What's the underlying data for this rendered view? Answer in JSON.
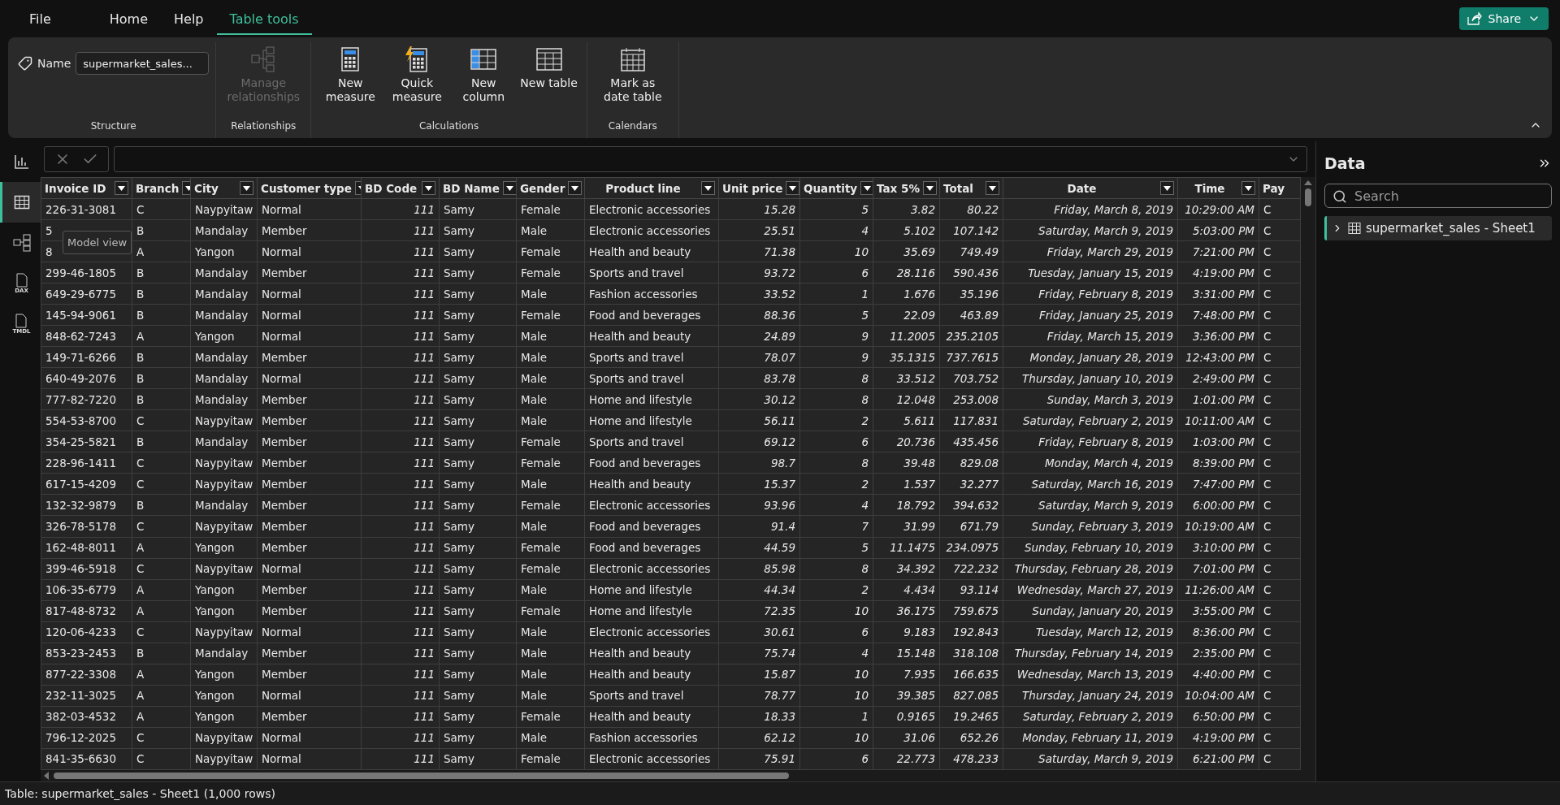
{
  "menu": {
    "tabs": [
      {
        "label": "File",
        "selected": false
      },
      {
        "label": "Home",
        "selected": false
      },
      {
        "label": "Help",
        "selected": false
      },
      {
        "label": "Table tools",
        "selected": true
      }
    ],
    "share": "Share"
  },
  "ribbon": {
    "name_field": {
      "label": "Name",
      "value": "supermarket_sales..."
    },
    "groups": [
      {
        "label": "Structure"
      },
      {
        "label": "Relationships",
        "items": [
          {
            "kind": "relationships",
            "label": "Manage relationships",
            "disabled": true
          }
        ]
      },
      {
        "label": "Calculations",
        "items": [
          {
            "kind": "measure",
            "label": "New measure",
            "disabled": false
          },
          {
            "kind": "quick-measure",
            "label": "Quick measure",
            "disabled": false
          },
          {
            "kind": "column",
            "label": "New column",
            "disabled": false
          },
          {
            "kind": "table",
            "label": "New table",
            "disabled": false
          }
        ]
      },
      {
        "label": "Calendars",
        "items": [
          {
            "kind": "date-table",
            "label": "Mark as date table",
            "disabled": false
          }
        ]
      }
    ]
  },
  "rail": [
    {
      "kind": "report",
      "selected": false
    },
    {
      "kind": "table",
      "selected": true
    },
    {
      "kind": "model",
      "selected": false,
      "tooltip": "Model view"
    },
    {
      "kind": "file",
      "badge": "DAX",
      "selected": false
    },
    {
      "kind": "file",
      "badge": "TMDL",
      "selected": false
    }
  ],
  "table": {
    "columns": [
      {
        "name": "Invoice ID",
        "kind": "text"
      },
      {
        "name": "Branch",
        "kind": "text"
      },
      {
        "name": "City",
        "kind": "text"
      },
      {
        "name": "Customer type",
        "kind": "text"
      },
      {
        "name": "BD Code",
        "kind": "number"
      },
      {
        "name": "BD Name",
        "kind": "text"
      },
      {
        "name": "Gender",
        "kind": "text"
      },
      {
        "name": "Product line",
        "kind": "text",
        "centered": true
      },
      {
        "name": "Unit price",
        "kind": "number"
      },
      {
        "name": "Quantity",
        "kind": "number"
      },
      {
        "name": "Tax 5%",
        "kind": "number"
      },
      {
        "name": "Total",
        "kind": "number"
      },
      {
        "name": "Date",
        "kind": "number",
        "centered": true
      },
      {
        "name": "Time",
        "kind": "number",
        "centered": true
      },
      {
        "name": "Pay",
        "kind": "text"
      }
    ],
    "rows": [
      [
        "226-31-3081",
        "C",
        "Naypyitaw",
        "Normal",
        "111",
        "Samy",
        "Female",
        "Electronic accessories",
        "15.28",
        "5",
        "3.82",
        "80.22",
        "Friday, March 8, 2019",
        "10:29:00 AM",
        "C"
      ],
      [
        "5",
        "B",
        "Mandalay",
        "Member",
        "111",
        "Samy",
        "Male",
        "Electronic accessories",
        "25.51",
        "4",
        "5.102",
        "107.142",
        "Saturday, March 9, 2019",
        "5:03:00 PM",
        "C"
      ],
      [
        "8",
        "A",
        "Yangon",
        "Normal",
        "111",
        "Samy",
        "Female",
        "Health and beauty",
        "71.38",
        "10",
        "35.69",
        "749.49",
        "Friday, March 29, 2019",
        "7:21:00 PM",
        "C"
      ],
      [
        "299-46-1805",
        "B",
        "Mandalay",
        "Member",
        "111",
        "Samy",
        "Female",
        "Sports and travel",
        "93.72",
        "6",
        "28.116",
        "590.436",
        "Tuesday, January 15, 2019",
        "4:19:00 PM",
        "C"
      ],
      [
        "649-29-6775",
        "B",
        "Mandalay",
        "Normal",
        "111",
        "Samy",
        "Male",
        "Fashion accessories",
        "33.52",
        "1",
        "1.676",
        "35.196",
        "Friday, February 8, 2019",
        "3:31:00 PM",
        "C"
      ],
      [
        "145-94-9061",
        "B",
        "Mandalay",
        "Normal",
        "111",
        "Samy",
        "Female",
        "Food and beverages",
        "88.36",
        "5",
        "22.09",
        "463.89",
        "Friday, January 25, 2019",
        "7:48:00 PM",
        "C"
      ],
      [
        "848-62-7243",
        "A",
        "Yangon",
        "Normal",
        "111",
        "Samy",
        "Male",
        "Health and beauty",
        "24.89",
        "9",
        "11.2005",
        "235.2105",
        "Friday, March 15, 2019",
        "3:36:00 PM",
        "C"
      ],
      [
        "149-71-6266",
        "B",
        "Mandalay",
        "Member",
        "111",
        "Samy",
        "Male",
        "Sports and travel",
        "78.07",
        "9",
        "35.1315",
        "737.7615",
        "Monday, January 28, 2019",
        "12:43:00 PM",
        "C"
      ],
      [
        "640-49-2076",
        "B",
        "Mandalay",
        "Normal",
        "111",
        "Samy",
        "Male",
        "Sports and travel",
        "83.78",
        "8",
        "33.512",
        "703.752",
        "Thursday, January 10, 2019",
        "2:49:00 PM",
        "C"
      ],
      [
        "777-82-7220",
        "B",
        "Mandalay",
        "Member",
        "111",
        "Samy",
        "Male",
        "Home and lifestyle",
        "30.12",
        "8",
        "12.048",
        "253.008",
        "Sunday, March 3, 2019",
        "1:01:00 PM",
        "C"
      ],
      [
        "554-53-8700",
        "C",
        "Naypyitaw",
        "Member",
        "111",
        "Samy",
        "Male",
        "Home and lifestyle",
        "56.11",
        "2",
        "5.611",
        "117.831",
        "Saturday, February 2, 2019",
        "10:11:00 AM",
        "C"
      ],
      [
        "354-25-5821",
        "B",
        "Mandalay",
        "Member",
        "111",
        "Samy",
        "Female",
        "Sports and travel",
        "69.12",
        "6",
        "20.736",
        "435.456",
        "Friday, February 8, 2019",
        "1:03:00 PM",
        "C"
      ],
      [
        "228-96-1411",
        "C",
        "Naypyitaw",
        "Member",
        "111",
        "Samy",
        "Female",
        "Food and beverages",
        "98.7",
        "8",
        "39.48",
        "829.08",
        "Monday, March 4, 2019",
        "8:39:00 PM",
        "C"
      ],
      [
        "617-15-4209",
        "C",
        "Naypyitaw",
        "Member",
        "111",
        "Samy",
        "Male",
        "Health and beauty",
        "15.37",
        "2",
        "1.537",
        "32.277",
        "Saturday, March 16, 2019",
        "7:47:00 PM",
        "C"
      ],
      [
        "132-32-9879",
        "B",
        "Mandalay",
        "Member",
        "111",
        "Samy",
        "Female",
        "Electronic accessories",
        "93.96",
        "4",
        "18.792",
        "394.632",
        "Saturday, March 9, 2019",
        "6:00:00 PM",
        "C"
      ],
      [
        "326-78-5178",
        "C",
        "Naypyitaw",
        "Member",
        "111",
        "Samy",
        "Male",
        "Food and beverages",
        "91.4",
        "7",
        "31.99",
        "671.79",
        "Sunday, February 3, 2019",
        "10:19:00 AM",
        "C"
      ],
      [
        "162-48-8011",
        "A",
        "Yangon",
        "Member",
        "111",
        "Samy",
        "Female",
        "Food and beverages",
        "44.59",
        "5",
        "11.1475",
        "234.0975",
        "Sunday, February 10, 2019",
        "3:10:00 PM",
        "C"
      ],
      [
        "399-46-5918",
        "C",
        "Naypyitaw",
        "Normal",
        "111",
        "Samy",
        "Female",
        "Electronic accessories",
        "85.98",
        "8",
        "34.392",
        "722.232",
        "Thursday, February 28, 2019",
        "7:01:00 PM",
        "C"
      ],
      [
        "106-35-6779",
        "A",
        "Yangon",
        "Member",
        "111",
        "Samy",
        "Male",
        "Home and lifestyle",
        "44.34",
        "2",
        "4.434",
        "93.114",
        "Wednesday, March 27, 2019",
        "11:26:00 AM",
        "C"
      ],
      [
        "817-48-8732",
        "A",
        "Yangon",
        "Member",
        "111",
        "Samy",
        "Female",
        "Home and lifestyle",
        "72.35",
        "10",
        "36.175",
        "759.675",
        "Sunday, January 20, 2019",
        "3:55:00 PM",
        "C"
      ],
      [
        "120-06-4233",
        "C",
        "Naypyitaw",
        "Normal",
        "111",
        "Samy",
        "Male",
        "Electronic accessories",
        "30.61",
        "6",
        "9.183",
        "192.843",
        "Tuesday, March 12, 2019",
        "8:36:00 PM",
        "C"
      ],
      [
        "853-23-2453",
        "B",
        "Mandalay",
        "Member",
        "111",
        "Samy",
        "Male",
        "Health and beauty",
        "75.74",
        "4",
        "15.148",
        "318.108",
        "Thursday, February 14, 2019",
        "2:35:00 PM",
        "C"
      ],
      [
        "877-22-3308",
        "A",
        "Yangon",
        "Member",
        "111",
        "Samy",
        "Male",
        "Health and beauty",
        "15.87",
        "10",
        "7.935",
        "166.635",
        "Wednesday, March 13, 2019",
        "4:40:00 PM",
        "C"
      ],
      [
        "232-11-3025",
        "A",
        "Yangon",
        "Normal",
        "111",
        "Samy",
        "Male",
        "Sports and travel",
        "78.77",
        "10",
        "39.385",
        "827.085",
        "Thursday, January 24, 2019",
        "10:04:00 AM",
        "C"
      ],
      [
        "382-03-4532",
        "A",
        "Yangon",
        "Member",
        "111",
        "Samy",
        "Female",
        "Health and beauty",
        "18.33",
        "1",
        "0.9165",
        "19.2465",
        "Saturday, February 2, 2019",
        "6:50:00 PM",
        "C"
      ],
      [
        "796-12-2025",
        "C",
        "Naypyitaw",
        "Normal",
        "111",
        "Samy",
        "Male",
        "Fashion accessories",
        "62.12",
        "10",
        "31.06",
        "652.26",
        "Monday, February 11, 2019",
        "4:19:00 PM",
        "C"
      ],
      [
        "841-35-6630",
        "C",
        "Naypyitaw",
        "Normal",
        "111",
        "Samy",
        "Female",
        "Electronic accessories",
        "75.91",
        "6",
        "22.773",
        "478.233",
        "Saturday, March 9, 2019",
        "6:21:00 PM",
        "C"
      ]
    ]
  },
  "data_pane": {
    "title": "Data",
    "search": {
      "placeholder": "Search"
    },
    "tree": [
      {
        "label": "supermarket_sales - Sheet1",
        "expanded": false,
        "selected": true
      }
    ]
  },
  "status_bar": "Table: supermarket_sales - Sheet1 (1,000 rows)"
}
